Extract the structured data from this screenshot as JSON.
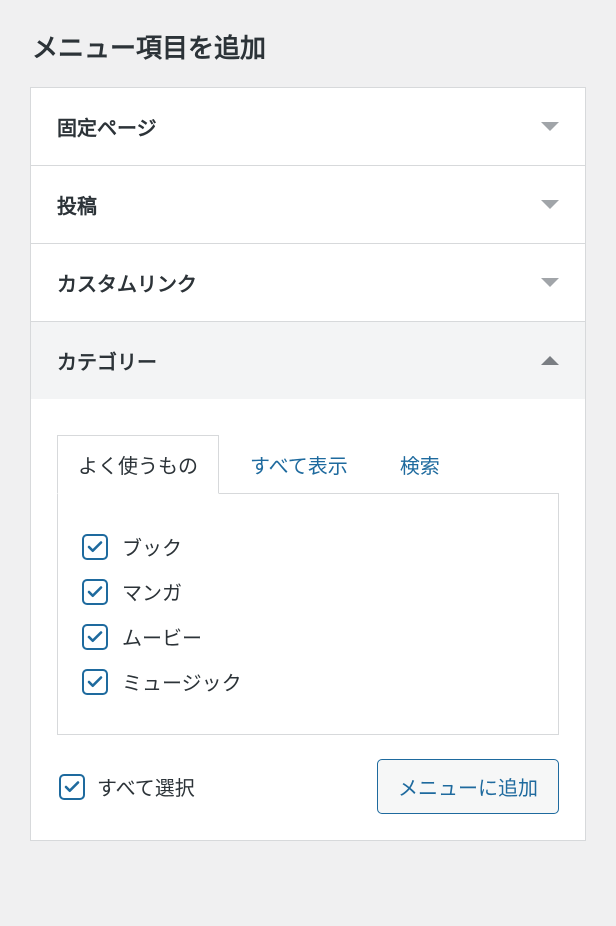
{
  "heading": "メニュー項目を追加",
  "sections": {
    "pages": {
      "title": "固定ページ"
    },
    "posts": {
      "title": "投稿"
    },
    "custom_links": {
      "title": "カスタムリンク"
    },
    "categories": {
      "title": "カテゴリー"
    }
  },
  "categories_panel": {
    "tabs": {
      "most_used": "よく使うもの",
      "view_all": "すべて表示",
      "search": "検索"
    },
    "items": [
      {
        "label": "ブック",
        "checked": true
      },
      {
        "label": "マンガ",
        "checked": true
      },
      {
        "label": "ムービー",
        "checked": true
      },
      {
        "label": "ミュージック",
        "checked": true
      }
    ],
    "select_all": {
      "label": "すべて選択",
      "checked": true
    },
    "add_button": "メニューに追加"
  },
  "colors": {
    "accent": "#1e6a9e"
  }
}
